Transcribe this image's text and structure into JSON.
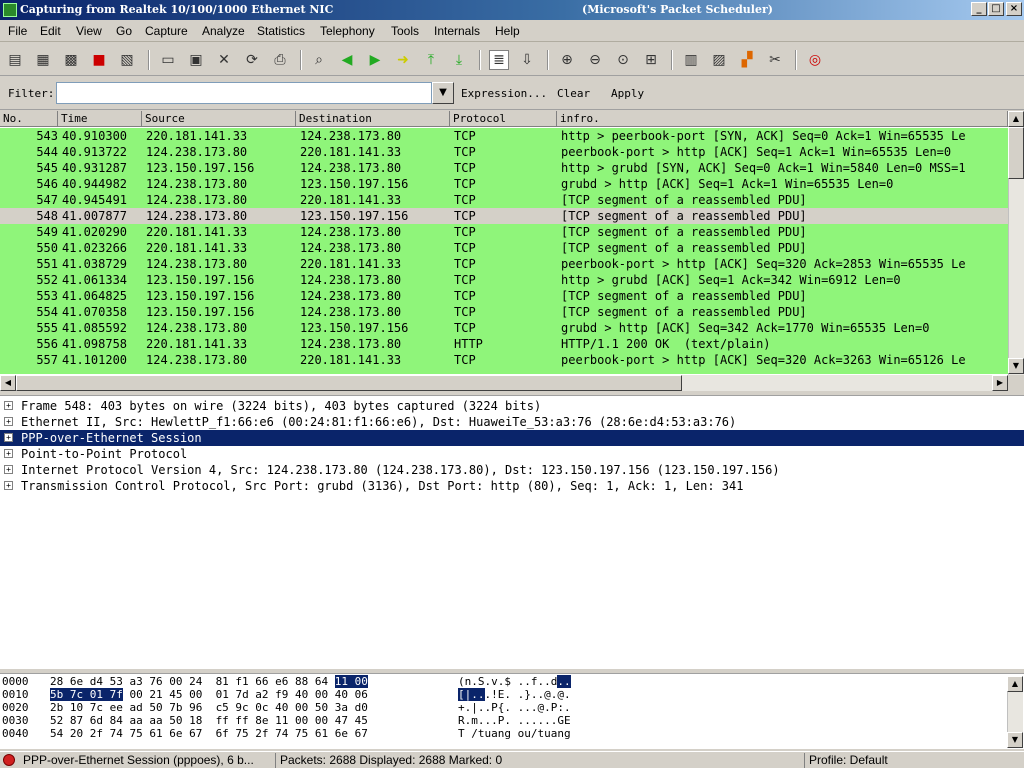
{
  "window": {
    "title_left": "Capturing from Realtek 10/100/1000 Ethernet NIC",
    "title_right": "(Microsoft's Packet Scheduler)",
    "buttons": {
      "minimize": "_",
      "maximize": "□",
      "close": "×"
    }
  },
  "menu": [
    "File",
    "Edit",
    "View",
    "Go",
    "Capture",
    "Analyze",
    "Statistics",
    "Telephony",
    "Tools",
    "Internals",
    "Help"
  ],
  "toolbar_icons": [
    "interfaces-icon",
    "capture-options-icon",
    "capture-start-icon",
    "capture-stop-icon",
    "capture-restart-icon",
    "open-icon",
    "save-icon",
    "close-file-icon",
    "reload-icon",
    "print-icon",
    "find-icon",
    "go-back-icon",
    "go-forward-icon",
    "go-to-packet-icon",
    "go-first-icon",
    "go-last-icon",
    "colorize-icon",
    "autoscroll-icon",
    "zoom-in-icon",
    "zoom-out-icon",
    "zoom-normal-icon",
    "resize-columns-icon",
    "capture-filters-icon",
    "display-filters-icon",
    "coloring-rules-icon",
    "preferences-icon",
    "help-icon"
  ],
  "filter": {
    "label": "Filter:",
    "value": "",
    "expression": "Expression...",
    "clear": "Clear",
    "apply": "Apply"
  },
  "columns": [
    "No.",
    "Time",
    "Source",
    "Destination",
    "Protocol",
    "infro."
  ],
  "packets": [
    {
      "no": "543",
      "time": "40.910300",
      "src": "220.181.141.33",
      "dst": "124.238.173.80",
      "proto": "TCP",
      "info": "http > peerbook-port [SYN, ACK] Seq=0 Ack=1 Win=65535 Le",
      "selected": false
    },
    {
      "no": "544",
      "time": "40.913722",
      "src": "124.238.173.80",
      "dst": "220.181.141.33",
      "proto": "TCP",
      "info": "peerbook-port > http [ACK] Seq=1 Ack=1 Win=65535 Len=0",
      "selected": false
    },
    {
      "no": "545",
      "time": "40.931287",
      "src": "123.150.197.156",
      "dst": "124.238.173.80",
      "proto": "TCP",
      "info": "http > grubd [SYN, ACK] Seq=0 Ack=1 Win=5840 Len=0 MSS=1",
      "selected": false
    },
    {
      "no": "546",
      "time": "40.944982",
      "src": "124.238.173.80",
      "dst": "123.150.197.156",
      "proto": "TCP",
      "info": "grubd > http [ACK] Seq=1 Ack=1 Win=65535 Len=0",
      "selected": false
    },
    {
      "no": "547",
      "time": "40.945491",
      "src": "124.238.173.80",
      "dst": "220.181.141.33",
      "proto": "TCP",
      "info": "[TCP segment of a reassembled PDU]",
      "selected": false
    },
    {
      "no": "548",
      "time": "41.007877",
      "src": "124.238.173.80",
      "dst": "123.150.197.156",
      "proto": "TCP",
      "info": "[TCP segment of a reassembled PDU]",
      "selected": true
    },
    {
      "no": "549",
      "time": "41.020290",
      "src": "220.181.141.33",
      "dst": "124.238.173.80",
      "proto": "TCP",
      "info": "[TCP segment of a reassembled PDU]",
      "selected": false
    },
    {
      "no": "550",
      "time": "41.023266",
      "src": "220.181.141.33",
      "dst": "124.238.173.80",
      "proto": "TCP",
      "info": "[TCP segment of a reassembled PDU]",
      "selected": false
    },
    {
      "no": "551",
      "time": "41.038729",
      "src": "124.238.173.80",
      "dst": "220.181.141.33",
      "proto": "TCP",
      "info": "peerbook-port > http [ACK] Seq=320 Ack=2853 Win=65535 Le",
      "selected": false
    },
    {
      "no": "552",
      "time": "41.061334",
      "src": "123.150.197.156",
      "dst": "124.238.173.80",
      "proto": "TCP",
      "info": "http > grubd [ACK] Seq=1 Ack=342 Win=6912 Len=0",
      "selected": false
    },
    {
      "no": "553",
      "time": "41.064825",
      "src": "123.150.197.156",
      "dst": "124.238.173.80",
      "proto": "TCP",
      "info": "[TCP segment of a reassembled PDU]",
      "selected": false
    },
    {
      "no": "554",
      "time": "41.070358",
      "src": "123.150.197.156",
      "dst": "124.238.173.80",
      "proto": "TCP",
      "info": "[TCP segment of a reassembled PDU]",
      "selected": false
    },
    {
      "no": "555",
      "time": "41.085592",
      "src": "124.238.173.80",
      "dst": "123.150.197.156",
      "proto": "TCP",
      "info": "grubd > http [ACK] Seq=342 Ack=1770 Win=65535 Len=0",
      "selected": false
    },
    {
      "no": "556",
      "time": "41.098758",
      "src": "220.181.141.33",
      "dst": "124.238.173.80",
      "proto": "HTTP",
      "info": "HTTP/1.1 200 OK  (text/plain)",
      "selected": false
    },
    {
      "no": "557",
      "time": "41.101200",
      "src": "124.238.173.80",
      "dst": "220.181.141.33",
      "proto": "TCP",
      "info": "peerbook-port > http [ACK] Seq=320 Ack=3263 Win=65126 Le",
      "selected": false
    }
  ],
  "details": [
    {
      "text": "Frame 548: 403 bytes on wire (3224 bits), 403 bytes captured (3224 bits)",
      "selected": false
    },
    {
      "text": "Ethernet II, Src: HewlettP_f1:66:e6 (00:24:81:f1:66:e6), Dst: HuaweiTe_53:a3:76 (28:6e:d4:53:a3:76)",
      "selected": false
    },
    {
      "text": "PPP-over-Ethernet Session",
      "selected": true
    },
    {
      "text": "Point-to-Point Protocol",
      "selected": false
    },
    {
      "text": "Internet Protocol Version 4, Src: 124.238.173.80 (124.238.173.80), Dst: 123.150.197.156 (123.150.197.156)",
      "selected": false
    },
    {
      "text": "Transmission Control Protocol, Src Port: grubd (3136), Dst Port: http (80), Seq: 1, Ack: 1, Len: 341",
      "selected": false
    }
  ],
  "hex": [
    {
      "off": "0000",
      "pre": "28 6e d4 53 a3 76 00 24  81 f1 66 e6 88 64 ",
      "sel": "11 00",
      "post": "",
      "apre": "(n.S.v.$ ..f..d",
      "asel": "..",
      "apost": ""
    },
    {
      "off": "0010",
      "pre": "",
      "sel": "5b 7c 01 7f",
      "post": " 00 21 45 00  01 7d a2 f9 40 00 40 06",
      "apre": "",
      "asel": "[|..",
      "apost": ".!E. .}..@.@."
    },
    {
      "off": "0020",
      "pre": "2b 10 7c ee ad 50 7b 96  c5 9c 0c 40 00 50 3a d0",
      "sel": "",
      "post": "",
      "apre": "+.|..P{. ...@.P:.",
      "asel": "",
      "apost": ""
    },
    {
      "off": "0030",
      "pre": "52 87 6d 84 aa aa 50 18  ff ff 8e 11 00 00 47 45",
      "sel": "",
      "post": "",
      "apre": "R.m...P. ......GE",
      "asel": "",
      "apost": ""
    },
    {
      "off": "0040",
      "pre": "54 20 2f 74 75 61 6e 67  6f 75 2f 74 75 61 6e 67",
      "sel": "",
      "post": "",
      "apre": "T /tuang ou/tuang",
      "asel": "",
      "apost": ""
    }
  ],
  "status": {
    "left": "PPP-over-Ethernet Session (pppoes), 6 b...",
    "middle": "Packets: 2688 Displayed: 2688 Marked: 0",
    "right": "Profile: Default"
  }
}
